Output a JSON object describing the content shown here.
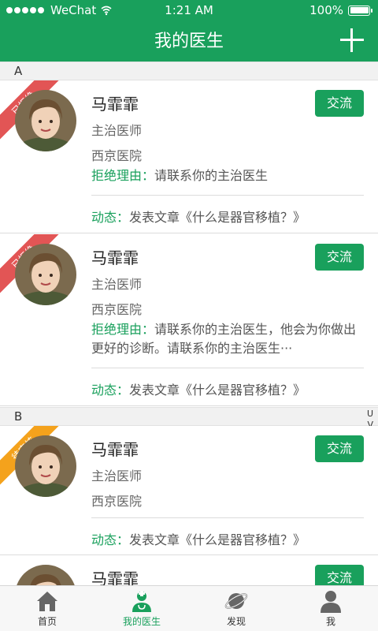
{
  "status_bar": {
    "carrier": "WeChat",
    "time": "1:21 AM",
    "battery": "100%"
  },
  "header": {
    "title": "我的医生"
  },
  "sections": {
    "a": "A",
    "b": "B"
  },
  "index_letters": [
    "U",
    "V"
  ],
  "doctors": [
    {
      "ribbon": "已拒绝",
      "name": "马霏霏",
      "title": "主治医师",
      "hospital": "西京医院",
      "reason_label": "拒绝理由：",
      "reason": "请联系你的主治医生",
      "activity_label": "动态：",
      "activity": "发表文章《什么是器官移植？》",
      "chat_label": "交流"
    },
    {
      "ribbon": "已拒绝",
      "name": "马霏霏",
      "title": "主治医师",
      "hospital": "西京医院",
      "reason_label": "拒绝理由：",
      "reason": "请联系你的主治医生，他会为你做出更好的诊断。请联系你的主治医生···",
      "activity_label": "动态：",
      "activity": "发表文章《什么是器官移植？》",
      "chat_label": "交流"
    },
    {
      "ribbon": "待审核",
      "name": "马霏霏",
      "title": "主治医师",
      "hospital": "西京医院",
      "activity_label": "动态：",
      "activity": "发表文章《什么是器官移植？》",
      "chat_label": "交流"
    },
    {
      "name": "马霏霏",
      "chat_label": "交流"
    }
  ],
  "tabs": [
    {
      "label": "首页",
      "icon": "home-icon"
    },
    {
      "label": "我的医生",
      "icon": "doctor-icon",
      "active": true
    },
    {
      "label": "发现",
      "icon": "planet-icon"
    },
    {
      "label": "我",
      "icon": "person-icon"
    }
  ],
  "colors": {
    "brand": "#19a05c",
    "rejected": "#e25555",
    "pending": "#f4a21c"
  }
}
